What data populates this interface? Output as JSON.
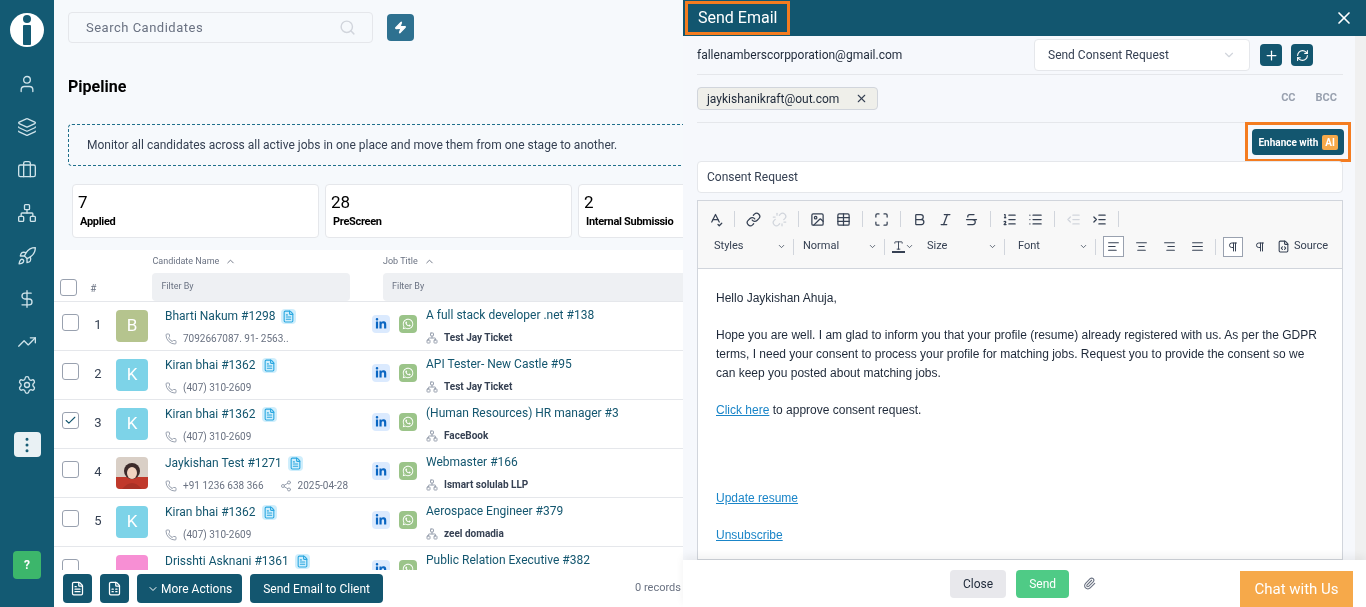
{
  "sidebar": {
    "items": [
      {
        "selected": false
      },
      {
        "selected": false
      },
      {
        "selected": false
      },
      {
        "selected": false
      },
      {
        "selected": false
      },
      {
        "selected": false
      },
      {
        "selected": false
      },
      {
        "selected": false
      },
      {
        "selected": true
      }
    ],
    "help": "?"
  },
  "search": {
    "placeholder": "Search Candidates"
  },
  "page_title": "Pipeline",
  "info": "Monitor all candidates across all active jobs in one place and move them from one stage to another.",
  "stages": [
    {
      "count": "7",
      "label": "Applied"
    },
    {
      "count": "28",
      "label": "PreScreen"
    },
    {
      "count": "2",
      "label": "Internal Submissio"
    }
  ],
  "table": {
    "select_all": {
      "checked": false
    },
    "columns": [
      {
        "label": "#"
      },
      {
        "label": "Candidate Name",
        "filter": "Filter By"
      },
      {
        "label": "Job Title",
        "filter": "Filter By"
      }
    ],
    "rows": [
      {
        "checked": false,
        "number": "1",
        "avatar": "B",
        "color": "#b5c48e",
        "name": "Bharti Nakum #1298",
        "phone": "7092667087. 91- 2563..",
        "job": "A full stack developer .net #138",
        "company": "Test Jay Ticket"
      },
      {
        "checked": false,
        "number": "2",
        "avatar": "K",
        "color": "#7dd3e8",
        "name": "Kiran bhai #1362",
        "phone": "(407) 310-2609",
        "job": "API Tester- New Castle #95",
        "company": "Test Jay Ticket"
      },
      {
        "checked": true,
        "number": "3",
        "avatar": "K",
        "color": "#7dd3e8",
        "name": "Kiran bhai #1362",
        "phone": "(407) 310-2609",
        "job": "(Human Resources) HR manager #3",
        "company": "FaceBook"
      },
      {
        "checked": false,
        "number": "4",
        "kind": "picture",
        "name": "Jaykishan Test #1271",
        "phone": "+91 1236 638 366",
        "date": "2025-04-28",
        "job": "Webmaster #166",
        "company": "Ismart solulab LLP"
      },
      {
        "checked": false,
        "number": "5",
        "avatar": "K",
        "color": "#7dd3e8",
        "name": "Kiran bhai #1362",
        "phone": "(407) 310-2609",
        "job": "Aerospace Engineer #379",
        "company": "zeel domadia"
      },
      {
        "checked": false,
        "color": "#f78fd4",
        "name": "Drisshti Asknani #1361",
        "job": "Public Relation Executive #382"
      }
    ]
  },
  "bottom_bar": {
    "buttons": [
      "More Actions",
      "Send Email to Client"
    ],
    "records": "0 records"
  },
  "dialog": {
    "title": "Send Email",
    "title_highlighted": true,
    "from": "fallenamberscorpporation@gmail.com",
    "template": "Send Consent Request",
    "recipients": [
      "jaykishanikraft@out.com"
    ],
    "cc": "CC",
    "bcc": "BCC",
    "enhance": {
      "label": "Enhance with",
      "badge": "AI",
      "highlighted": true
    },
    "subject": "Consent Request",
    "toolbar": {
      "styles": "Styles",
      "format": "Normal",
      "size": "Size",
      "font": "Font",
      "source": "Source"
    },
    "body": [
      {
        "kind": "text",
        "text": "Hello Jaykishan Ahuja,"
      },
      {
        "kind": "text",
        "text": "Hope you are well. I am glad to inform you that your profile (resume) already registered with us. As per the GDPR terms, I need your consent to process your profile for matching jobs. Request you to provide the consent so we can keep you posted about matching jobs."
      },
      {
        "kind": "link_text",
        "link": "Click here",
        "text": " to approve consent request."
      },
      {
        "kind": "spacer"
      },
      {
        "kind": "link",
        "link": "Update resume"
      },
      {
        "kind": "link",
        "link": "Unsubscribe"
      }
    ],
    "footer": {
      "close": "Close",
      "send": "Send"
    }
  },
  "chat": "Chat with Us"
}
